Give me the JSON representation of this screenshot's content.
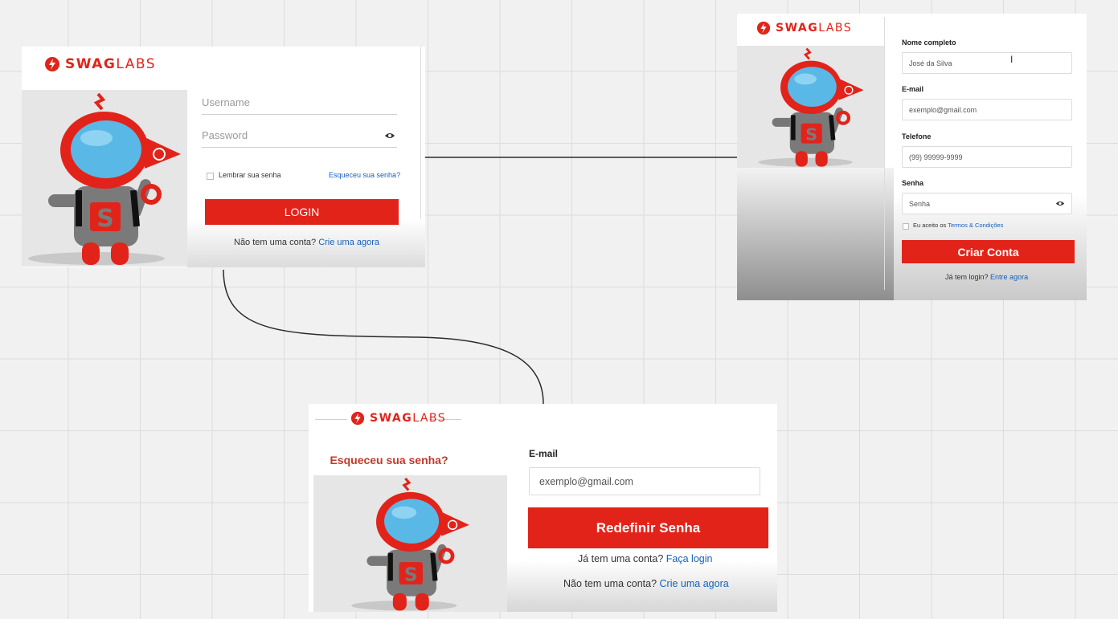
{
  "brand": {
    "bold": "SWAG",
    "light": "LABS",
    "color": "#e2231a"
  },
  "login": {
    "username_placeholder": "Username",
    "password_placeholder": "Password",
    "remember": "Lembrar sua senha",
    "forgot": "Esqueceu sua senha?",
    "button": "LOGIN",
    "no_account": "Não tem uma conta?",
    "create_link": "Crie uma agora"
  },
  "register": {
    "name_label": "Nome completo",
    "name_value": "José da Silva",
    "email_label": "E-mail",
    "email_placeholder": "exemplo@gmail.com",
    "phone_label": "Telefone",
    "phone_placeholder": "(99) 99999-9999",
    "password_label": "Senha",
    "password_placeholder": "Senha",
    "terms_prefix": "Eu aceito os",
    "terms_link": "Termos & Condições",
    "button": "Criar Conta",
    "have_login": "Já tem login?",
    "enter_link": "Entre agora"
  },
  "forgot": {
    "heading": "Esqueceu sua senha?",
    "email_label": "E-mail",
    "email_placeholder": "exemplo@gmail.com",
    "button": "Redefinir Senha",
    "have_account": "Já tem uma conta?",
    "login_link": "Faça login",
    "no_account": "Não tem uma conta?",
    "create_link": "Crie uma agora"
  },
  "icons": {
    "logo": "swaglabs-bolt-icon",
    "password_toggle": "eye-icon",
    "text_cursor": "i-beam-cursor-icon"
  },
  "colors": {
    "accent": "#e2231a",
    "link": "#1560bd",
    "canvas": "#f1f1f1"
  }
}
